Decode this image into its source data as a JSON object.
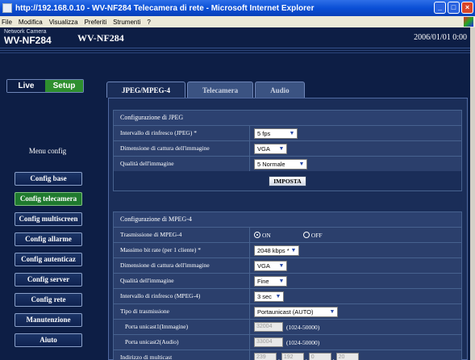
{
  "window": {
    "title": "http://192.168.0.10 - WV-NF284 Telecamera di rete - Microsoft Internet Explorer",
    "menu": [
      "File",
      "Modifica",
      "Visualizza",
      "Preferiti",
      "Strumenti",
      "?"
    ]
  },
  "header": {
    "camera_label": "Network Camera",
    "model": "WV-NF284",
    "model_title": "WV-NF284",
    "datetime": "2006/01/01 0:00"
  },
  "nav": {
    "live": "Live",
    "setup": "Setup",
    "menu_title": "Menu config",
    "items": [
      "Config base",
      "Config telecamera",
      "Config multiscreen",
      "Config allarme",
      "Config autenticaz",
      "Config server",
      "Config rete",
      "Manutenzione",
      "Aiuto"
    ]
  },
  "tabs": [
    "JPEG/MPEG-4",
    "Telecamera",
    "Audio"
  ],
  "jpeg": {
    "title": "Configurazione di JPEG",
    "rows": [
      {
        "label": "Intervallo di rinfresco (JPEG) *",
        "value": "5 fps"
      },
      {
        "label": "Dimensione di cattura dell'immagine",
        "value": "VGA"
      },
      {
        "label": "Qualità dell'immagine",
        "value": "5 Normale"
      }
    ],
    "set_button": "IMPOSTA"
  },
  "mpeg": {
    "title": "Configurazione di MPEG-4",
    "transmission_label": "Trasmissione di MPEG-4",
    "radio_on": "ON",
    "radio_off": "OFF",
    "rows": [
      {
        "label": "Massimo bit rate (per 1 cliente) *",
        "value": "2048 kbps *"
      },
      {
        "label": "Dimensione di cattura dell'immagine",
        "value": "VGA"
      },
      {
        "label": "Qualità dell'immagine",
        "value": "Fine"
      },
      {
        "label": "Intervallo di rinfresco (MPEG-4)",
        "value": "3 sec"
      },
      {
        "label": "Tipo di trasmissione",
        "value": "Portaunicast (AUTO)"
      }
    ],
    "port_image_label": "Porta unicast1(Immagine)",
    "port_image_value": "32004",
    "port_image_range": "(1024-50000)",
    "port_audio_label": "Porta unicast2(Audio)",
    "port_audio_value": "33004",
    "port_audio_range": "(1024-50000)",
    "multicast_label": "Indirizzo di multicast",
    "multicast": [
      "239",
      "192",
      "0",
      "20"
    ]
  }
}
